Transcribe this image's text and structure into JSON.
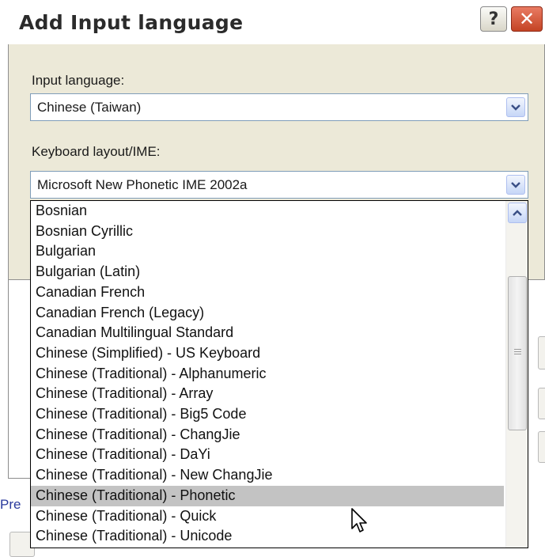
{
  "dialog": {
    "title": "Add Input language",
    "help_label": "?",
    "close_label": "✕"
  },
  "input_language": {
    "label": "Input language:",
    "value": "Chinese (Taiwan)"
  },
  "keyboard_layout": {
    "label": "Keyboard layout/IME:",
    "value": "Microsoft New Phonetic IME 2002a"
  },
  "dropdown": {
    "items": [
      "Bosnian",
      "Bosnian Cyrillic",
      "Bulgarian",
      "Bulgarian (Latin)",
      "Canadian French",
      "Canadian French (Legacy)",
      "Canadian Multilingual Standard",
      "Chinese (Simplified) - US Keyboard",
      "Chinese (Traditional) - Alphanumeric",
      "Chinese (Traditional) - Array",
      "Chinese (Traditional) - Big5 Code",
      "Chinese (Traditional) - ChangJie",
      "Chinese (Traditional) - DaYi",
      "Chinese (Traditional) - New ChangJie",
      "Chinese (Traditional) - Phonetic",
      "Chinese (Traditional) - Quick",
      "Chinese (Traditional) - Unicode"
    ],
    "selected_index": 14
  },
  "background": {
    "pre_text": "Pre"
  },
  "icons": {
    "help": "help-icon",
    "close": "close-icon",
    "dropdown_arrow": "chevron-down-icon",
    "scroll_up": "chevron-up-icon",
    "cursor": "mouse-pointer-icon"
  }
}
